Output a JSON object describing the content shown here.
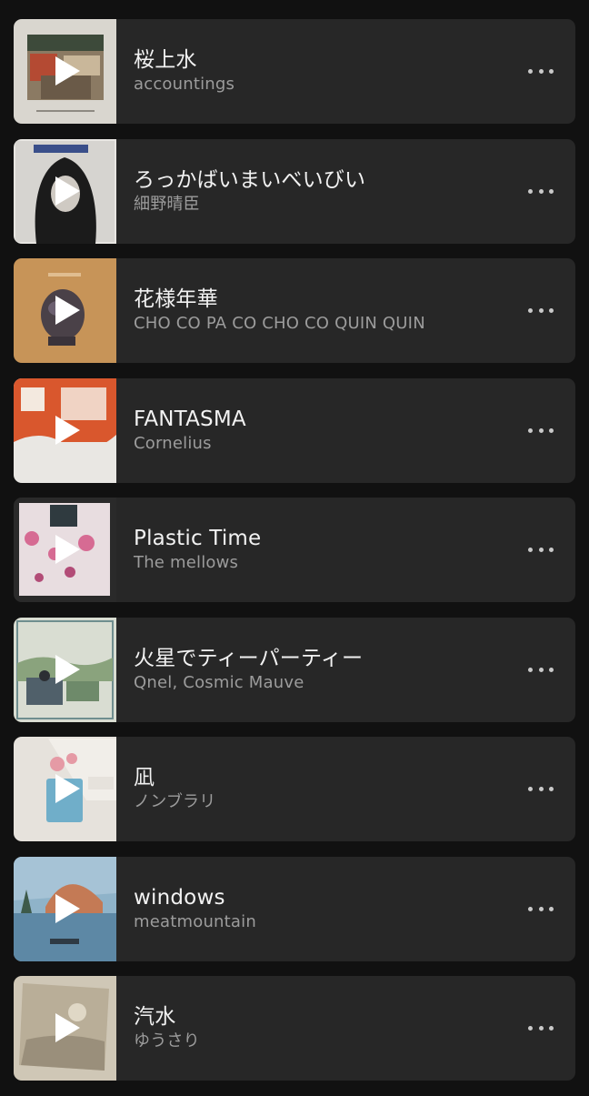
{
  "tracks": [
    {
      "title": "桜上水",
      "artist": "accountings",
      "art_icon": "album-art-accountings",
      "art_bg": "#d9d6cf",
      "art_accent": "#8b3b2a"
    },
    {
      "title": "ろっかばいまいべいびい",
      "artist": "細野晴臣",
      "art_icon": "album-art-hosono",
      "art_bg": "#e8e6e2",
      "art_accent": "#1a1a1a"
    },
    {
      "title": "花様年華",
      "artist": "CHO CO PA CO CHO CO QUIN QUIN",
      "art_icon": "album-art-tradition",
      "art_bg": "#c79458",
      "art_accent": "#4a4148"
    },
    {
      "title": "FANTASMA",
      "artist": "Cornelius",
      "art_icon": "album-art-fantasma",
      "art_bg": "#e9e7e3",
      "art_accent": "#d9572d"
    },
    {
      "title": "Plastic Time",
      "artist": "The mellows",
      "art_icon": "album-art-plastic-time",
      "art_bg": "#e8dde0",
      "art_accent": "#d66b93"
    },
    {
      "title": "火星でティーパーティー",
      "artist": "Qnel, Cosmic Mauve",
      "art_icon": "album-art-mars-tea-party",
      "art_bg": "#d9ddd2",
      "art_accent": "#6e8a6a"
    },
    {
      "title": "凪",
      "artist": "ノンブラリ",
      "art_icon": "album-art-nagi",
      "art_bg": "#e6e2dc",
      "art_accent": "#5aa5c5"
    },
    {
      "title": "windows",
      "artist": "meatmountain",
      "art_icon": "album-art-windows",
      "art_bg": "#8fb3c9",
      "art_accent": "#c47a55"
    },
    {
      "title": "汽水",
      "artist": "ゆうさり",
      "art_icon": "album-art-kisui",
      "art_bg": "#cfc7b6",
      "art_accent": "#9a8f7b"
    }
  ]
}
